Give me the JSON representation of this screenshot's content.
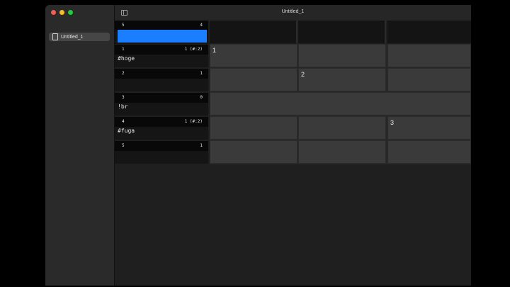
{
  "window": {
    "title": "Untitled_1"
  },
  "sidebar": {
    "items": [
      {
        "label": "Untitled_1"
      }
    ]
  },
  "header": {
    "row_number": "5",
    "count": "4"
  },
  "rows": [
    {
      "num": "1",
      "count": "1 (#:2)",
      "tag": "#hoge"
    },
    {
      "num": "2",
      "count": "1",
      "tag": ""
    },
    {
      "num": "3",
      "count": "0",
      "tag": "!br"
    },
    {
      "num": "4",
      "count": "1 (#:2)",
      "tag": "#fuga"
    },
    {
      "num": "5",
      "count": "1",
      "tag": ""
    }
  ],
  "cells": {
    "c1": "1",
    "c2": "2",
    "c3": "3"
  },
  "colors": {
    "accent": "#1a7eff"
  }
}
